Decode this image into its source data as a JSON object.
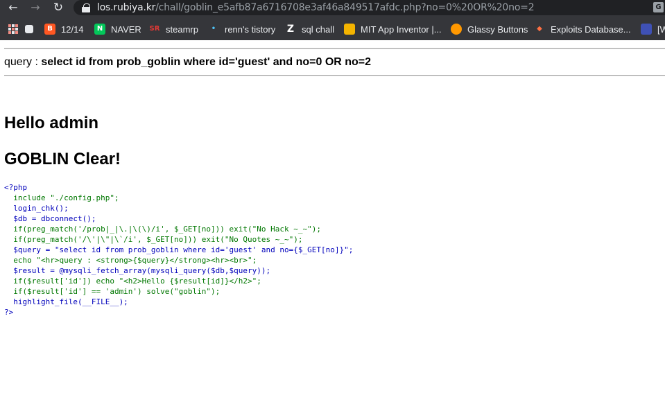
{
  "browser": {
    "url_host": "los.rubiya.kr",
    "url_path": "/chall/goblin_e5afb87a6716708e3af46a849517afdc.php?no=0%20OR%20no=2",
    "back_icon": "arrow-left-icon",
    "forward_icon": "arrow-right-icon",
    "reload_icon": "reload-icon"
  },
  "bookmarks": [
    {
      "label": "12/14",
      "icon": "blogger-icon",
      "color": "#ff5722"
    },
    {
      "label": "NAVER",
      "icon": "naver-icon",
      "color": "#03c75a"
    },
    {
      "label": "steamrp",
      "icon": "steamrp-icon",
      "color": "#e53935"
    },
    {
      "label": "renn's tistory",
      "icon": "tistory-icon",
      "color": "#4fc3f7"
    },
    {
      "label": "sql chall",
      "icon": "z-icon",
      "color": "#ffffff"
    },
    {
      "label": "MIT App Inventor |...",
      "icon": "app-inventor-icon",
      "color": "#f4b400"
    },
    {
      "label": "Glassy Buttons",
      "icon": "glassy-icon",
      "color": "#ff9800"
    },
    {
      "label": "Exploits Database...",
      "icon": "exploit-db-icon",
      "color": "#ff7043"
    }
  ],
  "bookmark_partial": "[W",
  "page": {
    "query_prefix": "query : ",
    "query_sql": "select id from prob_goblin where id='guest' and no=0 OR no=2",
    "hello": "Hello admin",
    "clear": "GOBLIN Clear!"
  },
  "source_lines": [
    "<?php",
    "  include \"./config.php\";",
    "  login_chk();",
    "  $db = dbconnect();",
    "  if(preg_match('/prob|_|\\.|\\(\\)/i', $_GET[no])) exit(\"No Hack ~_~\");",
    "  if(preg_match('/\\'|\\\"|\\`/i', $_GET[no])) exit(\"No Quotes ~_~\");",
    "  $query = \"select id from prob_goblin where id='guest' and no={$_GET[no]}\";",
    "  echo \"<hr>query : <strong>{$query}</strong><hr><br>\";",
    "  $result = @mysqli_fetch_array(mysqli_query($db,$query));",
    "  if($result['id']) echo \"<h2>Hello {$result[id]}</h2>\";",
    "  if($result['id'] == 'admin') solve(\"goblin\");",
    "  highlight_file(__FILE__);",
    "?>"
  ]
}
